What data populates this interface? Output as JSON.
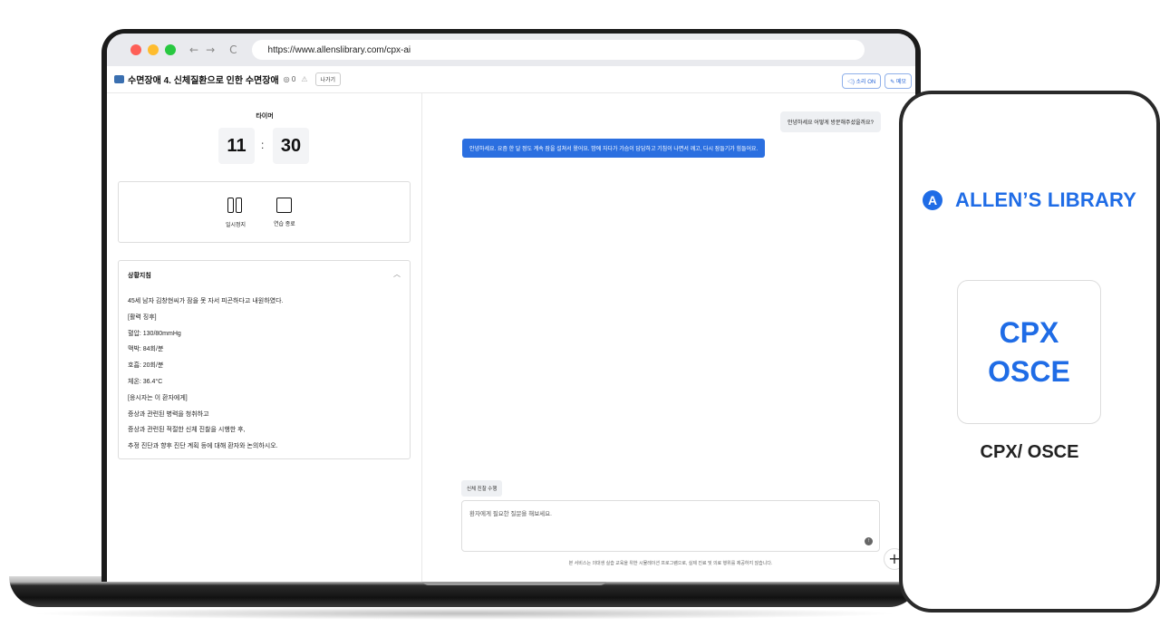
{
  "browser": {
    "url": "https://www.allenslibrary.com/cpx-ai",
    "back_icon": "←",
    "forward_icon": "→",
    "reload_icon": "C"
  },
  "header": {
    "case_title": "수면장애 4. 신체질환으로 인한 수면장애",
    "view_count": "0",
    "exit_label": "나가기",
    "sound_label": "소리 ON",
    "memo_label": "메모"
  },
  "timer": {
    "label": "타이머",
    "minutes": "11",
    "colon": ":",
    "seconds": "30"
  },
  "controls": {
    "pause_label": "일시정지",
    "end_label": "연습 종료"
  },
  "scenario": {
    "title": "상황지침",
    "lines": [
      "45세 남자 김창현씨가 잠을 못 자서 피곤하다고 내원하였다.",
      "[활력 징후]",
      "혈압: 130/80mmHg",
      "맥박: 84회/분",
      "호흡: 20회/분",
      "체온: 36.4°C",
      "[응시자는 이 환자에게]",
      "증상과 관련된 병력을 청취하고",
      "증상과 관련된 적절한 신체 진찰을 시행한 후,",
      "추정 진단과 향후 진단 계획 등에 대해 환자와 논의하시오."
    ]
  },
  "chat": {
    "question": "안녕하세요 어떻게 방문해주셨을까요?",
    "answer": "안녕하세요. 요즘 한 달 정도 계속 잠을 설쳐서 왔어요. 밤에 자다가 가슴이 답답하고 기침이 나면서 깨고, 다시 잠들기가 힘들어요.",
    "exam_chip": "신체 진찰 수행",
    "input_placeholder": "환자에게 필요한 질문을 해보세요.",
    "disclaimer": "본 서비스는 의대생 실습 교육을 위한 시뮬레이션 프로그램으로, 실제 진료 및 의료 행위를 제공하지 않습니다.",
    "plus_label": "+"
  },
  "phone": {
    "logo_letter": "A",
    "brand": "ALLEN’S LIBRARY",
    "tile_line1": "CPX",
    "tile_line2": "OSCE",
    "caption": "CPX/ OSCE"
  },
  "colors": {
    "brand_blue": "#1f6ce6",
    "chat_blue": "#2b6fe0",
    "mac_red": "#fe5f57",
    "mac_yellow": "#febc2e",
    "mac_green": "#28c840"
  }
}
